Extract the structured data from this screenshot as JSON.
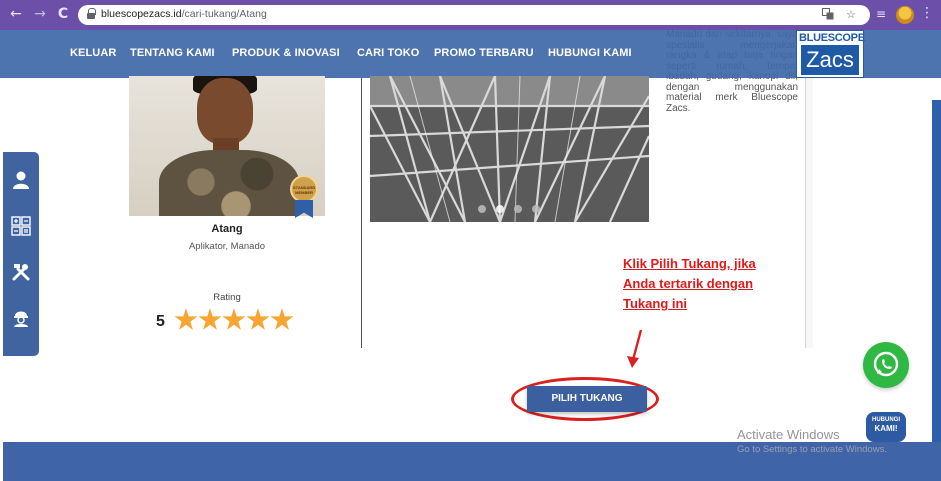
{
  "browser": {
    "url_domain": "bluescopezacs.id",
    "url_path": "/cari-tukang/Atang",
    "nav_back": "←",
    "nav_forward": "→",
    "nav_reload": "C",
    "translate_icon": "translate-icon",
    "bookmark_icon": "☆",
    "media_icon": "≡",
    "menu_icon": "⋮"
  },
  "site_nav": {
    "items": [
      "KELUAR",
      "TENTANG KAMI",
      "PRODUK & INOVASI",
      "CARI TOKO",
      "PROMO TERBARU",
      "HUBUNGI KAMI"
    ],
    "logo_top": "BLUESCOPE",
    "logo_bottom": "Zacs"
  },
  "sidebar": {
    "icons": [
      "user-icon",
      "calculator-icon",
      "tools-icon",
      "worker-icon"
    ]
  },
  "profile": {
    "badge_text": "STANDARD MEMBER",
    "name": "Atang",
    "role": "Aplikator, Manado",
    "rating_label": "Rating",
    "rating_value": "5",
    "stars": 5
  },
  "gallery": {
    "dots": 4,
    "active_dot": 2
  },
  "description": "Manado dan sekitarnya, saya spesialis mengerjakan rangka & atap baja ringan seperti rumah, tempat ibadah, gudang, kanopi dll, dengan menggunakan material merk Bluescope Zacs.",
  "annotation": {
    "lines": [
      "Klik Pilih Tukang, jika",
      "Anda tertarik dengan",
      "Tukang ini"
    ]
  },
  "cta": {
    "label": "PILIH TUKANG"
  },
  "widgets": {
    "whatsapp_icon": "whatsapp-icon",
    "hubungi_line1": "HUBUNGI",
    "hubungi_line2": "KAMI!"
  },
  "watermark": {
    "title": "Activate Windows",
    "subtitle": "Go to Settings to activate Windows."
  }
}
